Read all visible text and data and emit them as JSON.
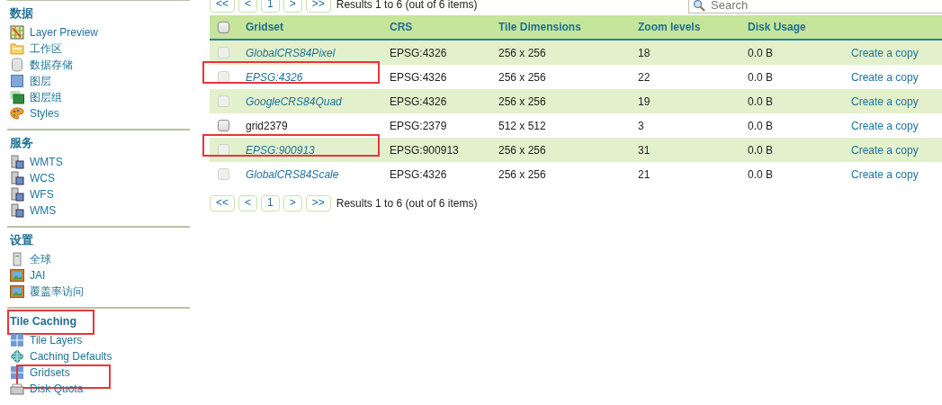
{
  "sidebar": {
    "sections": [
      {
        "heading": "数据",
        "annotated": false,
        "items": [
          {
            "label": "Layer Preview",
            "kind": "preview",
            "annotated": false
          },
          {
            "label": "工作区",
            "kind": "folder",
            "annotated": false
          },
          {
            "label": "数据存储",
            "kind": "database",
            "annotated": false
          },
          {
            "label": "图层",
            "kind": "layer",
            "annotated": false
          },
          {
            "label": "图层组",
            "kind": "layergroup",
            "annotated": false
          },
          {
            "label": "Styles",
            "kind": "palette",
            "annotated": false
          }
        ]
      },
      {
        "heading": "服务",
        "annotated": false,
        "items": [
          {
            "label": "WMTS",
            "kind": "server",
            "annotated": false
          },
          {
            "label": "WCS",
            "kind": "server",
            "annotated": false
          },
          {
            "label": "WFS",
            "kind": "server",
            "annotated": false
          },
          {
            "label": "WMS",
            "kind": "server",
            "annotated": false
          }
        ]
      },
      {
        "heading": "设置",
        "annotated": false,
        "items": [
          {
            "label": "全球",
            "kind": "computer",
            "annotated": false
          },
          {
            "label": "JAI",
            "kind": "image",
            "annotated": false
          },
          {
            "label": "覆盖率访问",
            "kind": "image",
            "annotated": false
          }
        ]
      },
      {
        "heading": "Tile Caching",
        "annotated": true,
        "items": [
          {
            "label": "Tile Layers",
            "kind": "tiles",
            "annotated": false
          },
          {
            "label": "Caching Defaults",
            "kind": "globe",
            "annotated": false
          },
          {
            "label": "Gridsets",
            "kind": "tiles",
            "annotated": true
          },
          {
            "label": "Disk Quota",
            "kind": "disk",
            "annotated": false
          }
        ]
      }
    ]
  },
  "pager_top": {
    "buttons": [
      "<<",
      "<",
      "1",
      ">",
      ">>"
    ],
    "summary": "Results 1 to 6 (out of 6 items)"
  },
  "search": {
    "placeholder": "Search"
  },
  "table": {
    "select_all_checked": false,
    "columns": [
      "Gridset",
      "CRS",
      "Tile Dimensions",
      "Zoom levels",
      "Disk Usage"
    ],
    "rows": [
      {
        "gridset": "GlobalCRS84Pixel",
        "builtin": true,
        "annotated": false,
        "crs": "EPSG:4326",
        "tile_dimensions": "256 x 256",
        "zoom_levels": "18",
        "disk_usage": "0.0 B",
        "action": "Create a copy"
      },
      {
        "gridset": "EPSG:4326",
        "builtin": true,
        "annotated": true,
        "crs": "EPSG:4326",
        "tile_dimensions": "256 x 256",
        "zoom_levels": "22",
        "disk_usage": "0.0 B",
        "action": "Create a copy"
      },
      {
        "gridset": "GoogleCRS84Quad",
        "builtin": true,
        "annotated": false,
        "crs": "EPSG:4326",
        "tile_dimensions": "256 x 256",
        "zoom_levels": "19",
        "disk_usage": "0.0 B",
        "action": "Create a copy"
      },
      {
        "gridset": "grid2379",
        "builtin": false,
        "annotated": false,
        "crs": "EPSG:2379",
        "tile_dimensions": "512 x 512",
        "zoom_levels": "3",
        "disk_usage": "0.0 B",
        "action": "Create a copy"
      },
      {
        "gridset": "EPSG:900913",
        "builtin": true,
        "annotated": true,
        "crs": "EPSG:900913",
        "tile_dimensions": "256 x 256",
        "zoom_levels": "31",
        "disk_usage": "0.0 B",
        "action": "Create a copy"
      },
      {
        "gridset": "GlobalCRS84Scale",
        "builtin": true,
        "annotated": false,
        "crs": "EPSG:4326",
        "tile_dimensions": "256 x 256",
        "zoom_levels": "21",
        "disk_usage": "0.0 B",
        "action": "Create a copy"
      }
    ]
  },
  "pager_bottom": {
    "buttons": [
      "<<",
      "<",
      "1",
      ">",
      ">>"
    ],
    "summary": "Results 1 to 6 (out of 6 items)"
  }
}
